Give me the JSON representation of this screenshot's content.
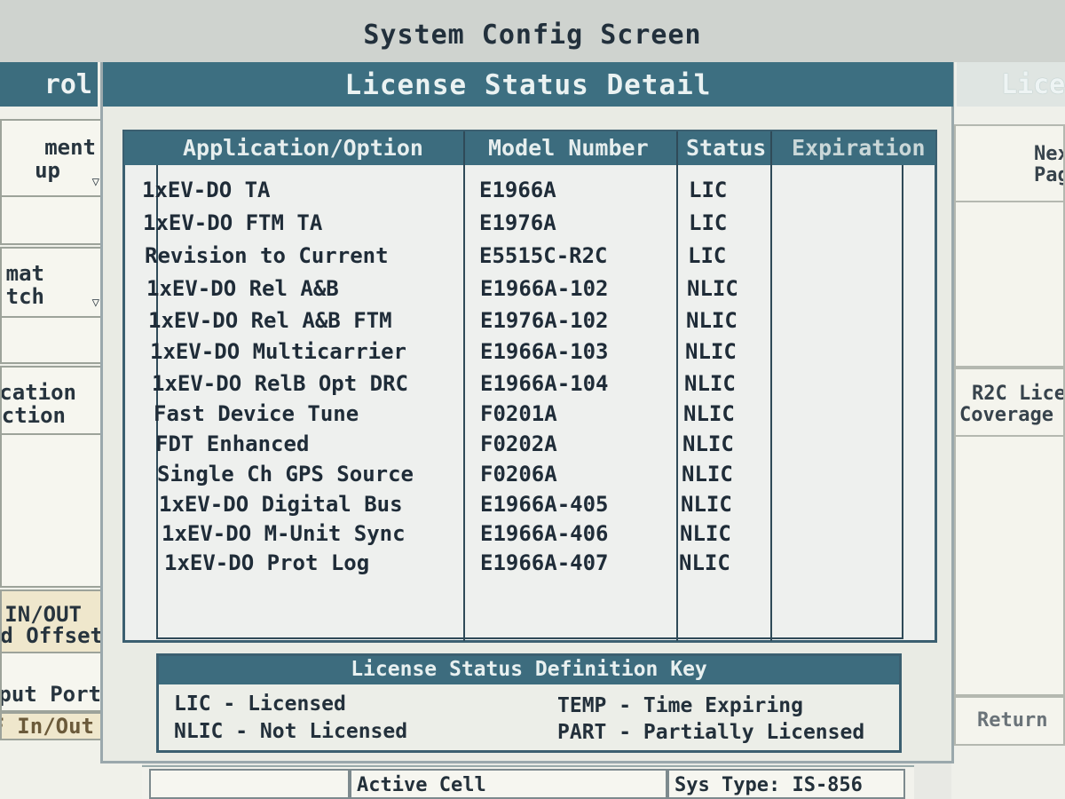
{
  "window": {
    "title": "System Config Screen"
  },
  "left_panel": {
    "header": "rol",
    "keys": [
      {
        "line1": "ment",
        "line2": "up",
        "has_dropdown": true
      },
      {
        "line1": "mat",
        "line2": "tch",
        "has_dropdown": true
      },
      {
        "line1": "ication",
        "line2": "ection",
        "has_dropdown": false
      },
      {
        "line1": "IN/OUT",
        "line2": "td Offset",
        "has_dropdown": false
      },
      {
        "line1": "tput Port",
        "line2": "",
        "has_dropdown": false
      },
      {
        "line1": "F In/Out",
        "line2": "",
        "has_dropdown": false
      }
    ]
  },
  "right_panel": {
    "header": "Lice",
    "keys": [
      {
        "line1": "Nex",
        "line2": "Pag"
      },
      {
        "line1": "R2C Lice",
        "line2": "Coverage"
      },
      {
        "line1": "Return",
        "line2": ""
      }
    ]
  },
  "main": {
    "title": "License Status Detail",
    "table": {
      "columns": [
        "Application/Option",
        "Model Number",
        "Status",
        "Expiration"
      ],
      "rows": [
        {
          "app": "1xEV-DO TA",
          "model": "E1966A",
          "status": "LIC",
          "expiration": ""
        },
        {
          "app": "1xEV-DO FTM TA",
          "model": "E1976A",
          "status": "LIC",
          "expiration": ""
        },
        {
          "app": "Revision to Current",
          "model": "E5515C-R2C",
          "status": "LIC",
          "expiration": ""
        },
        {
          "app": "1xEV-DO Rel A&B",
          "model": "E1966A-102",
          "status": "NLIC",
          "expiration": ""
        },
        {
          "app": "1xEV-DO Rel A&B FTM",
          "model": "E1976A-102",
          "status": "NLIC",
          "expiration": ""
        },
        {
          "app": "1xEV-DO Multicarrier",
          "model": "E1966A-103",
          "status": "NLIC",
          "expiration": ""
        },
        {
          "app": "1xEV-DO RelB Opt DRC",
          "model": "E1966A-104",
          "status": "NLIC",
          "expiration": ""
        },
        {
          "app": "Fast Device Tune",
          "model": "F0201A",
          "status": "NLIC",
          "expiration": ""
        },
        {
          "app": "FDT Enhanced",
          "model": "F0202A",
          "status": "NLIC",
          "expiration": ""
        },
        {
          "app": "Single Ch GPS Source",
          "model": "F0206A",
          "status": "NLIC",
          "expiration": ""
        },
        {
          "app": "1xEV-DO Digital Bus",
          "model": "E1966A-405",
          "status": "NLIC",
          "expiration": ""
        },
        {
          "app": "1xEV-DO M-Unit Sync",
          "model": "E1966A-406",
          "status": "NLIC",
          "expiration": ""
        },
        {
          "app": "1xEV-DO Prot Log",
          "model": "E1966A-407",
          "status": "NLIC",
          "expiration": ""
        }
      ]
    },
    "definition_key": {
      "title": "License Status Definition Key",
      "items": [
        "LIC - Licensed",
        "NLIC - Not Licensed",
        "TEMP - Time Expiring",
        "PART - Partially Licensed"
      ]
    }
  },
  "status_bar": {
    "active_cell": "Active Cell",
    "sys_type": "Sys Type: IS-856"
  },
  "colors": {
    "header_teal": "#3d6f81",
    "background": "#e9ebe4",
    "text": "#1d2a36"
  }
}
